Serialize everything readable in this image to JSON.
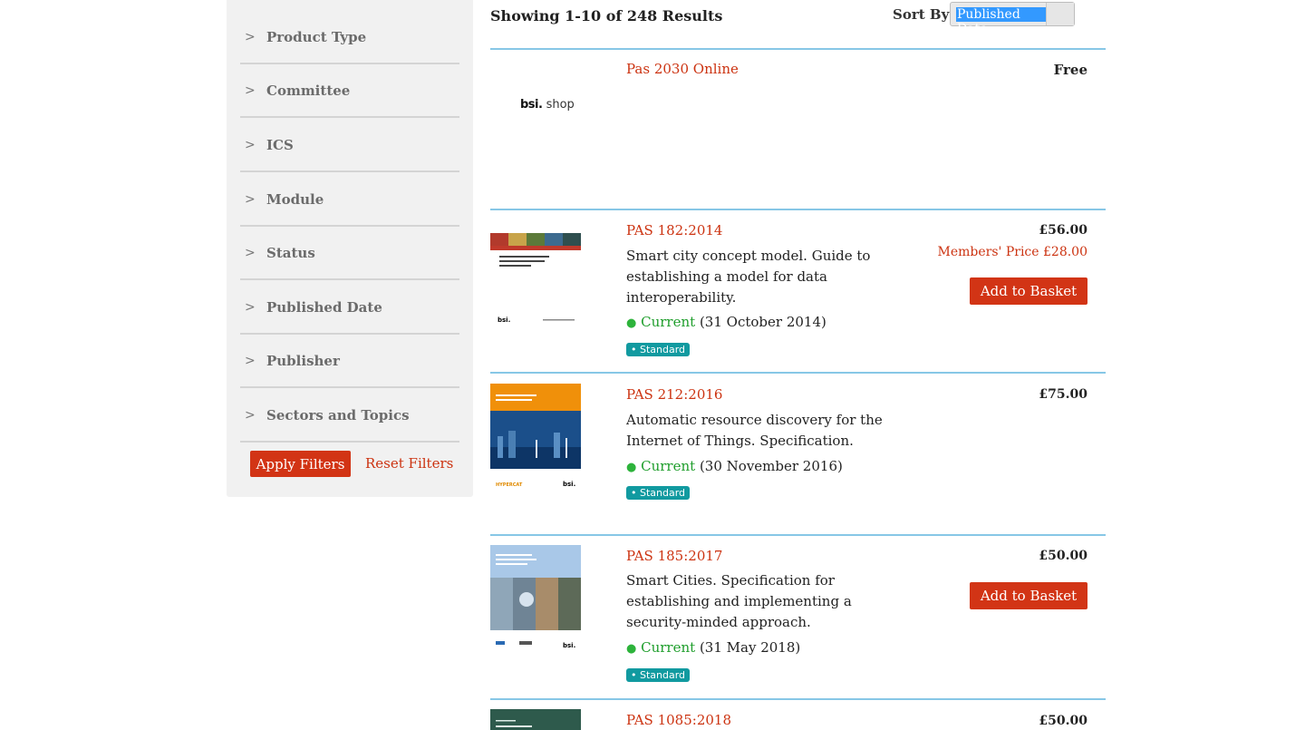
{
  "sidebar": {
    "filters": [
      {
        "label": "Product Type"
      },
      {
        "label": "Committee"
      },
      {
        "label": "ICS"
      },
      {
        "label": "Module"
      },
      {
        "label": "Status"
      },
      {
        "label": "Published Date"
      },
      {
        "label": "Publisher"
      },
      {
        "label": "Sectors and Topics"
      }
    ],
    "chevron": ">",
    "apply_label": "Apply Filters",
    "reset_label": "Reset Filters"
  },
  "header": {
    "results_text": "Showing 1-10 of 248 Results",
    "sort_label": "Sort By",
    "sort_value": "Published Date"
  },
  "products": [
    {
      "title": "Pas 2030 Online",
      "price": "Free",
      "logo_bold": "bsi.",
      "logo_rest": " shop"
    },
    {
      "title": "PAS 182:2014",
      "description": "Smart city concept model. Guide to establishing a model for data interoperability.",
      "status": "Current",
      "date": "(31 October 2014)",
      "badge": "• Standard",
      "price": "£56.00",
      "member_price": "Members' Price  £28.00",
      "button": "Add to Basket",
      "cover_text": "Smart city concept model – Guide to establishing a model for data interoperability",
      "cover_brand": "bsi."
    },
    {
      "title": "PAS 212:2016",
      "description": "Automatic resource discovery for the Internet of Things. Specification.",
      "status": "Current",
      "date": "(30 November 2016)",
      "badge": "• Standard",
      "price": "£75.00",
      "cover_text": "Automatic resource discovery for the Internet of Things – Specification",
      "cover_brand": "bsi.",
      "cover_partner": "HYPERCAT"
    },
    {
      "title": "PAS 185:2017",
      "description": "Smart Cities. Specification for establishing and implementing a security-minded approach.",
      "status": "Current",
      "date": "(31 May 2018)",
      "badge": "• Standard",
      "price": "£50.00",
      "button": "Add to Basket",
      "cover_text": "Smart cities – Specification for establishing and implementing a security-minded approach",
      "cover_brand": "bsi."
    },
    {
      "title": "PAS 1085:2018",
      "price": "£50.00"
    }
  ],
  "colors": {
    "accent": "#d23415",
    "link": "#cc3311",
    "divider": "#87c7e6",
    "badge": "#119aa0",
    "current": "#1f9e2c"
  }
}
